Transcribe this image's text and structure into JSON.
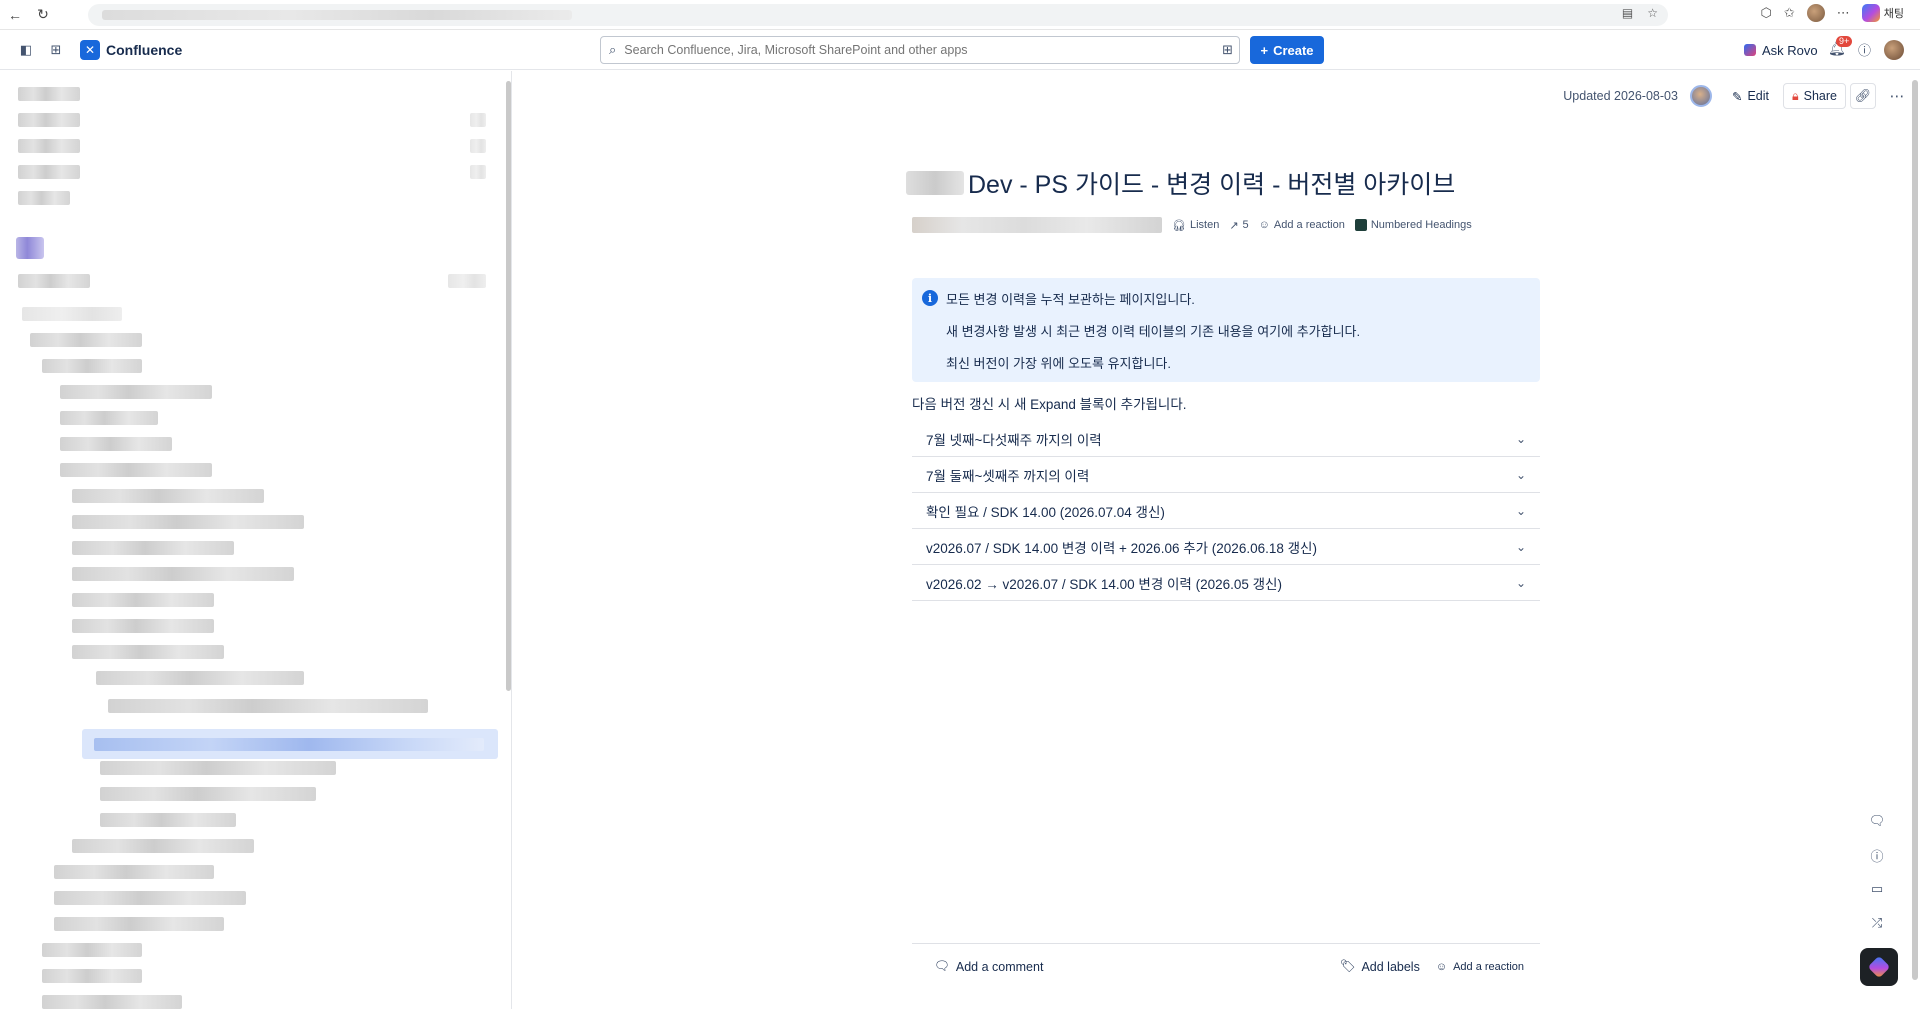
{
  "browser": {
    "chat_label": "채팅"
  },
  "topnav": {
    "app_name": "Confluence",
    "search_placeholder": "Search Confluence, Jira, Microsoft SharePoint and other apps",
    "create_label": "Create",
    "ask_rovo_label": "Ask Rovo",
    "notification_badge": "9+"
  },
  "page": {
    "updated": "Updated 2026-08-03",
    "edit_label": "Edit",
    "share_label": "Share",
    "title": "Dev - PS 가이드 - 변경 이력 - 버전별 아카이브",
    "byline": {
      "listen": "Listen",
      "views": "5",
      "add_reaction": "Add a reaction",
      "numbered_headings": "Numbered Headings"
    },
    "info_panel": [
      "모든 변경 이력을 누적 보관하는 페이지입니다.",
      "새 변경사항 발생 시 최근 변경 이력 테이블의 기존 내용을 여기에 추가합니다.",
      "최신 버전이 가장 위에 오도록 유지합니다."
    ],
    "note": "다음 버전 갱신 시 새 Expand 블록이 추가됩니다.",
    "expands": [
      "7월 넷째~다섯째주 까지의 이력",
      "7월 둘째~셋째주 까지의 이력",
      "확인 필요 / SDK 14.00 (2026.07.04 갱신)",
      "v2026.07 / SDK 14.00 변경 이력 + 2026.06 추가 (2026.06.18 갱신)",
      "v2026.02 → v2026.07 / SDK 14.00 변경 이력 (2026.05 갱신)"
    ],
    "footer": {
      "add_comment": "Add a comment",
      "add_labels": "Add labels",
      "add_reaction": "Add a reaction"
    }
  }
}
